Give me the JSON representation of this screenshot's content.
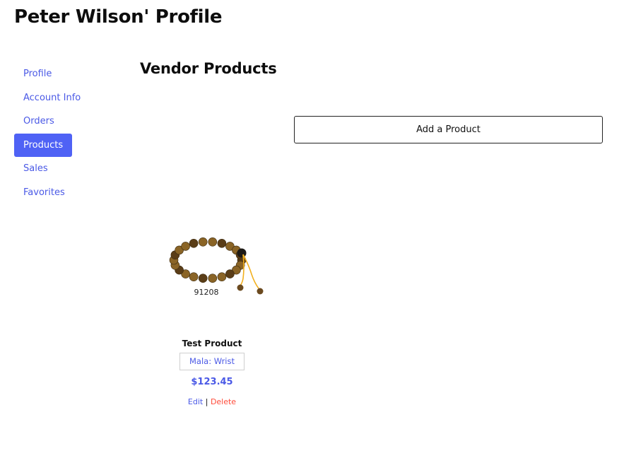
{
  "header": {
    "title": "Peter Wilson' Profile"
  },
  "sidebar": {
    "items": [
      {
        "label": "Profile",
        "active": false
      },
      {
        "label": "Account Info",
        "active": false
      },
      {
        "label": "Orders",
        "active": false
      },
      {
        "label": "Products",
        "active": true
      },
      {
        "label": "Sales",
        "active": false
      },
      {
        "label": "Favorites",
        "active": false
      }
    ]
  },
  "main": {
    "title": "Vendor Products",
    "add_button_label": "Add a Product",
    "products": [
      {
        "image_code": "91208",
        "image_icon": "bead-bracelet-image",
        "name": "Test Product",
        "category": "Mala: Wrist",
        "price": "$123.45",
        "edit_label": "Edit",
        "separator": "|",
        "delete_label": "Delete"
      }
    ]
  },
  "colors": {
    "accent": "#4f62f5",
    "link": "#4a59e6",
    "danger": "#ff4b3a"
  }
}
